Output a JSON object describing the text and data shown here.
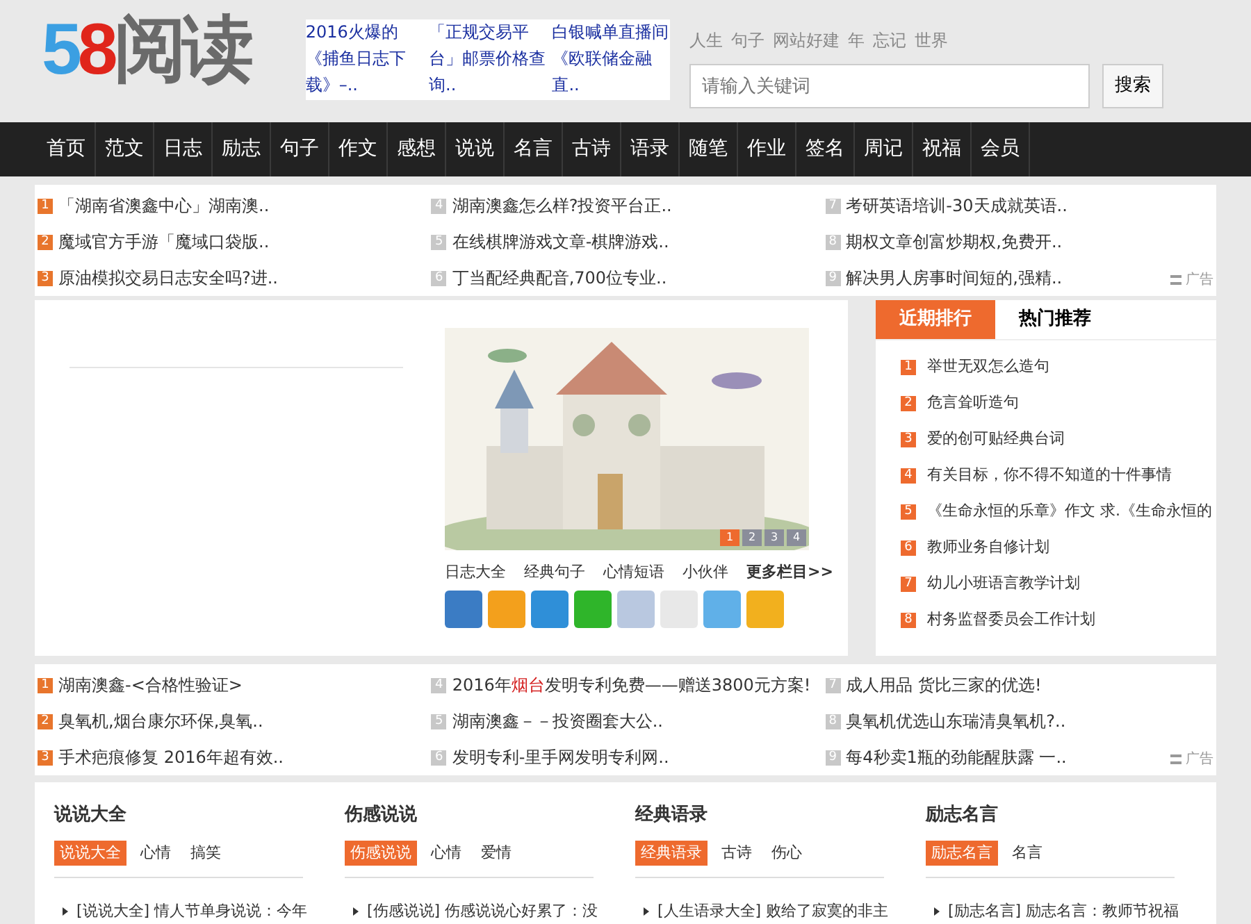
{
  "logo": [
    {
      "text": "5",
      "color": "#3b9fe2"
    },
    {
      "text": "8",
      "color": "#e0251b"
    },
    {
      "text": "阅读",
      "color": "#6a6a6a"
    }
  ],
  "header_ads": [
    "2016火爆的《捕鱼日志下载》–..",
    "「正规交易平台」邮票价格查询..",
    "白银喊单直播间《欧联储金融直.."
  ],
  "hot_words": [
    "人生",
    "句子",
    "网站好建",
    "年",
    "忘记",
    "世界"
  ],
  "search": {
    "placeholder": "请输入关键词",
    "button": "搜索"
  },
  "nav": [
    "首页",
    "范文",
    "日志",
    "励志",
    "句子",
    "作文",
    "感想",
    "说说",
    "名言",
    "古诗",
    "语录",
    "随笔",
    "作业",
    "签名",
    "周记",
    "祝福",
    "会员"
  ],
  "ad_block_1": {
    "ad_label": "广告",
    "items": [
      {
        "num": "1",
        "color": "#e8752c",
        "segments": [
          {
            "text": "「湖南省澳鑫中心」湖南澳..",
            "accent": false
          }
        ]
      },
      {
        "num": "2",
        "color": "#e8752c",
        "segments": [
          {
            "text": "魔域官方手游「魔域口袋版..",
            "accent": false
          }
        ]
      },
      {
        "num": "3",
        "color": "#e8752c",
        "segments": [
          {
            "text": "原油模拟交易日志安全吗?进..",
            "accent": false
          }
        ]
      },
      {
        "num": "4",
        "color": "#c8c8c8",
        "segments": [
          {
            "text": "湖南澳鑫怎么样?投资平台正..",
            "accent": false
          }
        ]
      },
      {
        "num": "5",
        "color": "#c8c8c8",
        "segments": [
          {
            "text": "在线棋牌游戏文章-棋牌游戏..",
            "accent": false
          }
        ]
      },
      {
        "num": "6",
        "color": "#c8c8c8",
        "segments": [
          {
            "text": "丁当配经典配音,700位专业..",
            "accent": false
          }
        ]
      },
      {
        "num": "7",
        "color": "#c8c8c8",
        "segments": [
          {
            "text": "考研英语培训-30天成就英语..",
            "accent": false
          }
        ]
      },
      {
        "num": "8",
        "color": "#c8c8c8",
        "segments": [
          {
            "text": "期权文章创富炒期权,免费开..",
            "accent": false
          }
        ]
      },
      {
        "num": "9",
        "color": "#c8c8c8",
        "segments": [
          {
            "text": "解决男人房事时间短的,强精..",
            "accent": false
          }
        ]
      }
    ]
  },
  "slider": {
    "dots": [
      {
        "label": "1",
        "selected": true
      },
      {
        "label": "2",
        "selected": false
      },
      {
        "label": "3",
        "selected": false
      },
      {
        "label": "4",
        "selected": false
      }
    ],
    "links": [
      {
        "text": "日志大全",
        "kind": "link"
      },
      {
        "text": "经典句子",
        "kind": "link"
      },
      {
        "text": "心情短语",
        "kind": "link"
      },
      {
        "text": "小伙伴",
        "kind": "link"
      },
      {
        "text": "更多栏目>>",
        "kind": "more"
      }
    ]
  },
  "ranking": {
    "tabs": [
      {
        "label": "近期排行",
        "selected": true
      },
      {
        "label": "热门推荐",
        "selected": false
      }
    ],
    "items": [
      {
        "num": "1",
        "text": "举世无双怎么造句"
      },
      {
        "num": "2",
        "text": "危言耸听造句"
      },
      {
        "num": "3",
        "text": "爱的创可贴经典台词"
      },
      {
        "num": "4",
        "text": "有关目标，你不得不知道的十件事情"
      },
      {
        "num": "5",
        "text": "《生命永恒的乐章》作文 求.《生命永恒的"
      },
      {
        "num": "6",
        "text": "教师业务自修计划"
      },
      {
        "num": "7",
        "text": "幼儿小班语言教学计划"
      },
      {
        "num": "8",
        "text": "村务监督委员会工作计划"
      }
    ]
  },
  "ad_block_2": {
    "ad_label": "广告",
    "items": [
      {
        "num": "1",
        "color": "#e8752c",
        "segments": [
          {
            "text": "湖南澳鑫-<合格性验证>",
            "accent": false
          }
        ]
      },
      {
        "num": "2",
        "color": "#e8752c",
        "segments": [
          {
            "text": "臭氧机,烟台康尔环保,臭氧..",
            "accent": false
          }
        ]
      },
      {
        "num": "3",
        "color": "#e8752c",
        "segments": [
          {
            "text": "手术疤痕修复 2016年超有效..",
            "accent": false
          }
        ]
      },
      {
        "num": "4",
        "color": "#c8c8c8",
        "segments": [
          {
            "text": "2016年",
            "accent": false
          },
          {
            "text": "烟台",
            "accent": true
          },
          {
            "text": "发明专利免费——赠送3800元方案!",
            "accent": false
          }
        ]
      },
      {
        "num": "5",
        "color": "#c8c8c8",
        "segments": [
          {
            "text": "湖南澳鑫－－投资圈套大公..",
            "accent": false
          }
        ]
      },
      {
        "num": "6",
        "color": "#c8c8c8",
        "segments": [
          {
            "text": "发明专利-里手网发明专利网..",
            "accent": false
          }
        ]
      },
      {
        "num": "7",
        "color": "#c8c8c8",
        "segments": [
          {
            "text": "成人用品 货比三家的优选!",
            "accent": false
          }
        ]
      },
      {
        "num": "8",
        "color": "#c8c8c8",
        "segments": [
          {
            "text": "臭氧机优选山东瑞清臭氧机?..",
            "accent": false
          }
        ]
      },
      {
        "num": "9",
        "color": "#c8c8c8",
        "segments": [
          {
            "text": "每4秒卖1瓶的劲能醒肤露 一..",
            "accent": false
          }
        ]
      }
    ]
  },
  "sections": [
    {
      "title": "说说大全",
      "tabs": [
        {
          "label": "说说大全",
          "selected": true
        },
        {
          "label": "心情",
          "selected": false
        },
        {
          "label": "搞笑",
          "selected": false
        }
      ],
      "items": [
        "[说说大全] 情人节单身说说：今年"
      ]
    },
    {
      "title": "伤感说说",
      "tabs": [
        {
          "label": "伤感说说",
          "selected": true
        },
        {
          "label": "心情",
          "selected": false
        },
        {
          "label": "爱情",
          "selected": false
        }
      ],
      "items": [
        "[伤感说说] 伤感说说心好累了：没"
      ]
    },
    {
      "title": "经典语录",
      "tabs": [
        {
          "label": "经典语录",
          "selected": true
        },
        {
          "label": "古诗",
          "selected": false
        },
        {
          "label": "伤心",
          "selected": false
        }
      ],
      "items": [
        "[人生语录大全] 败给了寂寞的非主"
      ]
    },
    {
      "title": "励志名言",
      "tabs": [
        {
          "label": "励志名言",
          "selected": true
        },
        {
          "label": "名言",
          "selected": false
        }
      ],
      "items": [
        "[励志名言] 励志名言：教师节祝福"
      ]
    }
  ]
}
